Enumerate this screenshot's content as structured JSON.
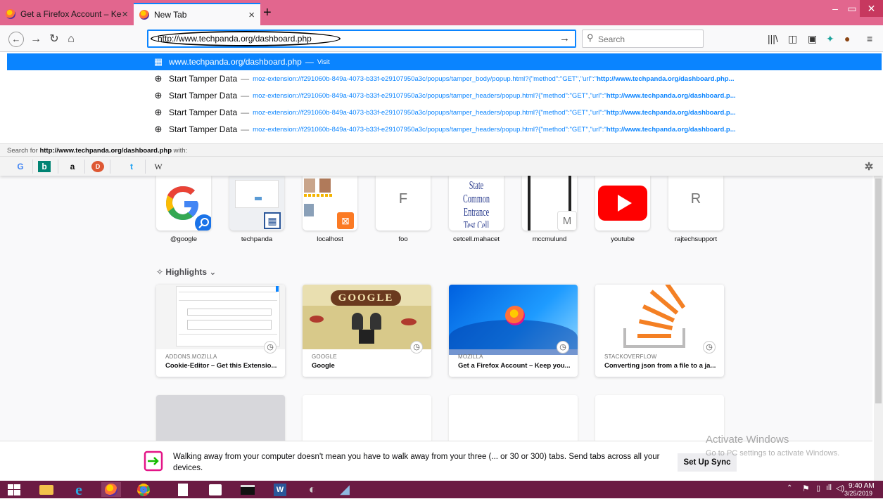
{
  "tabs": [
    {
      "label": "Get a Firefox Account – Keep y"
    },
    {
      "label": "New Tab"
    }
  ],
  "urlbar": {
    "value": "http://www.techpanda.org/dashboard.php"
  },
  "searchbar": {
    "placeholder": "Search"
  },
  "autocomplete": {
    "rows": [
      {
        "title": "www.techpanda.org/dashboard.php",
        "sep": "—",
        "action": "Visit"
      },
      {
        "title": "Start Tamper Data",
        "sep": "—",
        "url_prefix": "moz-extension://f291060b-849a-4073-b33f-e29107950a3c/popups/tamper_body/popup.html?{\"method\":\"GET\",\"url\":\"",
        "url_bold": "http://www.techpanda.org/dashboard.php..."
      },
      {
        "title": "Start Tamper Data",
        "sep": "—",
        "url_prefix": "moz-extension://f291060b-849a-4073-b33f-e29107950a3c/popups/tamper_headers/popup.html?{\"method\":\"GET\",\"url\":\"",
        "url_bold": "http://www.techpanda.org/dashboard.p..."
      },
      {
        "title": "Start Tamper Data",
        "sep": "—",
        "url_prefix": "moz-extension://f291060b-849a-4073-b33f-e29107950a3c/popups/tamper_headers/popup.html?{\"method\":\"GET\",\"url\":\"",
        "url_bold": "http://www.techpanda.org/dashboard.p..."
      },
      {
        "title": "Start Tamper Data",
        "sep": "—",
        "url_prefix": "moz-extension://f291060b-849a-4073-b33f-e29107950a3c/popups/tamper_headers/popup.html?{\"method\":\"GET\",\"url\":\"",
        "url_bold": "http://www.techpanda.org/dashboard.p..."
      }
    ],
    "search_with_prefix": "Search for ",
    "search_with_query": "http://www.techpanda.org/dashboard.php",
    "search_with_suffix": " with:",
    "engines": [
      "G",
      "b",
      "a",
      "D",
      "t",
      "W"
    ]
  },
  "top_sites": [
    {
      "label": "@google"
    },
    {
      "label": "techpanda"
    },
    {
      "label": "localhost"
    },
    {
      "label": "foo",
      "letter": "F"
    },
    {
      "label": "cetcell.mahacet",
      "thumb_text": "State Common Entrance Test Cell"
    },
    {
      "label": "mccmulund",
      "letter": "M"
    },
    {
      "label": "youtube"
    },
    {
      "label": "rajtechsupport",
      "letter": "R"
    }
  ],
  "highlights": {
    "title": "Highlights",
    "cards": [
      {
        "source": "ADDONS.MOZILLA",
        "title": "Cookie-Editor – Get this Extensio..."
      },
      {
        "source": "GOOGLE",
        "title": "Google",
        "thumb_text": "GOOGLE"
      },
      {
        "source": "MOZILLA",
        "title": "Get a Firefox Account – Keep you..."
      },
      {
        "source": "STACKOVERFLOW",
        "title": "Converting json from a file to a ja..."
      }
    ]
  },
  "sync": {
    "message": "Walking away from your computer doesn't mean you have to walk away from your three (... or 30 or 300) tabs. Send tabs across all your devices.",
    "button": "Set Up Sync"
  },
  "watermark": {
    "line1": "Activate Windows",
    "line2": "Go to PC settings to activate Windows."
  },
  "taskbar": {
    "time": "9:40 AM",
    "date": "3/25/2019"
  },
  "colors": {
    "titlebar": "#e2668e",
    "accent": "#0a84ff",
    "taskbar": "#6b1b43"
  }
}
